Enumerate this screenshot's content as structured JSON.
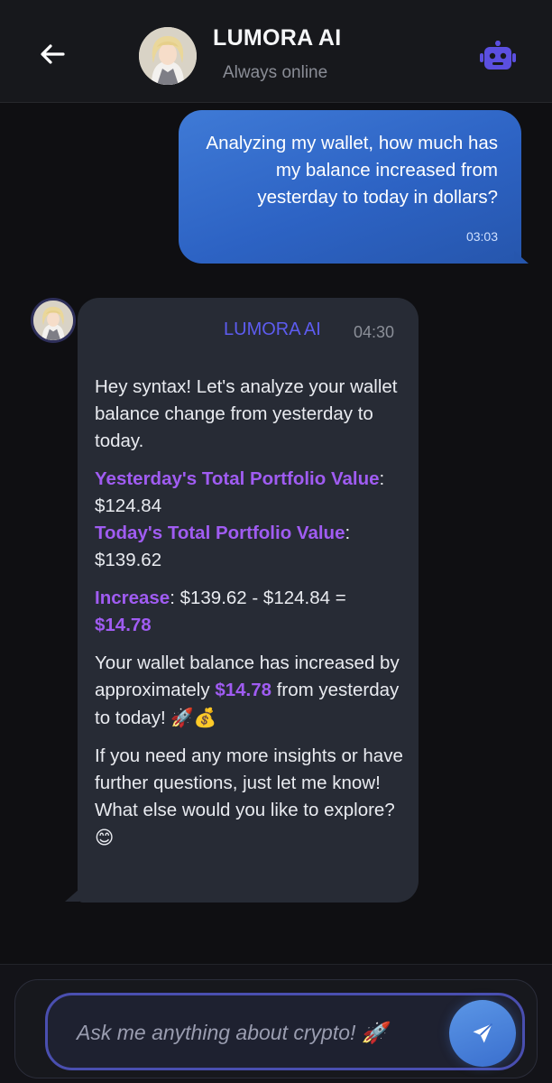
{
  "header": {
    "title": "LUMORA AI",
    "status": "Always online"
  },
  "user_message": {
    "text": "Analyzing my wallet, how much has my balance increased from yesterday to today in dollars?",
    "time": "03:03"
  },
  "ai_message": {
    "sender": "LUMORA AI",
    "time": "04:30",
    "greeting": "Hey syntax! Let's analyze your wallet balance change from yesterday to today.",
    "yesterday_label": "Yesterday's Total Portfolio Value",
    "yesterday_value": ": $124.84",
    "today_label": "Today's Total Portfolio Value",
    "today_value": ": $139.62",
    "increase_label": "Increase",
    "increase_calc": ": $139.62 - $124.84 = ",
    "increase_result": "$14.78",
    "summary_prefix": "Your wallet balance has increased by approximately ",
    "summary_amount": "$14.78",
    "summary_suffix": " from yesterday to today! ",
    "summary_emojis": "🚀💰",
    "closing": "If you need any more insights or have further questions, just let me know! What else would you like to explore? ",
    "closing_emoji": "😊"
  },
  "input": {
    "placeholder": "Ask me anything about crypto! 🚀"
  },
  "icons": {
    "back": "back-arrow-icon",
    "robot": "robot-icon",
    "send": "send-icon"
  },
  "colors": {
    "accent_purple": "#a05cf2",
    "ai_name": "#5d5cf0",
    "user_bubble": "#3f7ad6",
    "robot_icon": "#5b4fe0"
  }
}
